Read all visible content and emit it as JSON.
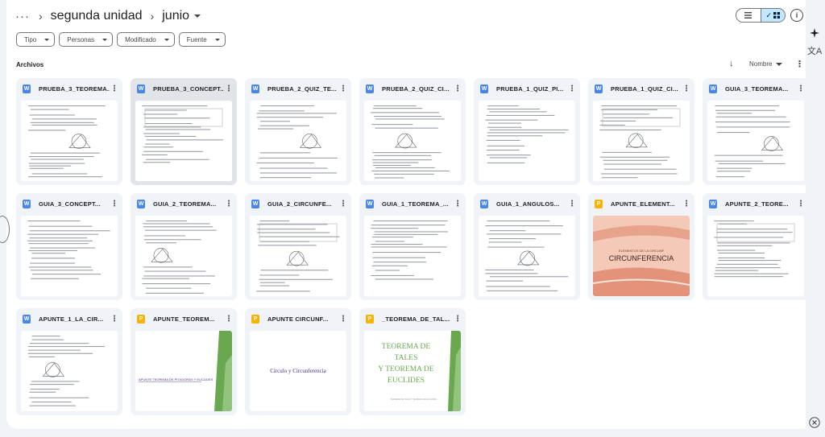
{
  "header": {
    "more_label": "···",
    "breadcrumb_parent": "segunda unidad",
    "breadcrumb_current": "junio"
  },
  "view_toggle": {
    "list_icon": "list-icon",
    "grid_icon": "grid-icon",
    "selected": "grid"
  },
  "filters": [
    "Tipo",
    "Personas",
    "Modificado",
    "Fuente"
  ],
  "section": {
    "label": "Archivos"
  },
  "sort": {
    "label": "Nombre",
    "direction": "descending"
  },
  "files": [
    {
      "name": "PRUEBA_3_TEOREMA...",
      "type": "word",
      "thumb": "doc"
    },
    {
      "name": "PRUEBA_3_CONCEPT...",
      "type": "word",
      "thumb": "doc",
      "selected": true
    },
    {
      "name": "PRUEBA_2_QUIZ_TE...",
      "type": "word",
      "thumb": "doc"
    },
    {
      "name": "PRUEBA_2_QUIZ_CI...",
      "type": "word",
      "thumb": "doc"
    },
    {
      "name": "PRUEBA_1_QUIZ_PI...",
      "type": "word",
      "thumb": "doc"
    },
    {
      "name": "PRUEBA_1_QUIZ_CI...",
      "type": "word",
      "thumb": "doc"
    },
    {
      "name": "GUIA_3_TEOREMA...",
      "type": "word",
      "thumb": "doc"
    },
    {
      "name": "GUIA_3_CONCEPT...",
      "type": "word",
      "thumb": "doc"
    },
    {
      "name": "GUIA_2_TEOREMA...",
      "type": "word",
      "thumb": "doc"
    },
    {
      "name": "GUIA_2_CIRCUNFE...",
      "type": "word",
      "thumb": "doc"
    },
    {
      "name": "GUIA_1_TEOREMA_...",
      "type": "word",
      "thumb": "doc"
    },
    {
      "name": "GUIA_1_ANGULOS...",
      "type": "word",
      "thumb": "doc"
    },
    {
      "name": "APUNTE_ELEMENT...",
      "type": "slides",
      "thumb": "slide-pink",
      "slide_title": "CIRCUNFERENCIA",
      "slide_sub": "ELEMENTOS DE LA CIRCUNF"
    },
    {
      "name": "APUNTE_2_TEORE...",
      "type": "word",
      "thumb": "doc"
    },
    {
      "name": "APUNTE_1_LA_CIR...",
      "type": "word",
      "thumb": "doc"
    },
    {
      "name": "APUNTE_TEOREM...",
      "type": "slides",
      "thumb": "slide-green",
      "slide_title": "APUNTE TEOREMA DE PITAGORAS Y EUCLIDES"
    },
    {
      "name": "APUNTE CIRCUNF...",
      "type": "slides",
      "thumb": "slide-plain",
      "slide_title": "Círculo  y  Circunferencia"
    },
    {
      "name": "_TEOREMA_DE_TAL...",
      "type": "slides",
      "thumb": "slide-green-big",
      "slide_title": "TEOREMA DE TALES Y TEOREMA DE EUCLIDES"
    }
  ],
  "rail": {
    "gemini_icon": "sparkle-icon",
    "translate_icon": "translate-icon",
    "close_icon": "close-icon"
  },
  "colors": {
    "word": "#4a86e8",
    "slides": "#f6b400",
    "selected_toggle": "#c2e7ff"
  }
}
